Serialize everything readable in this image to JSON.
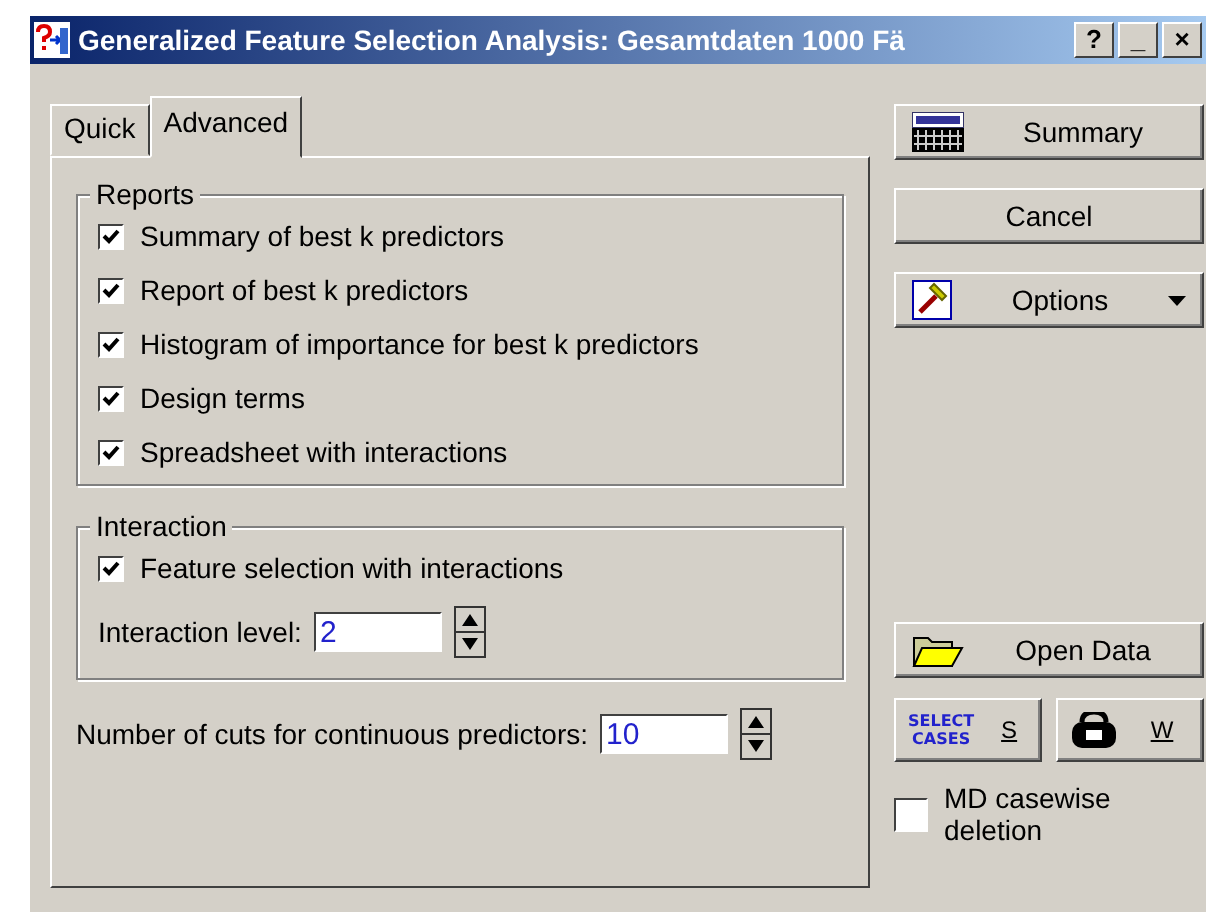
{
  "window": {
    "title": "Generalized Feature Selection Analysis: Gesamtdaten 1000 Fä",
    "controls": [
      "?",
      "_",
      "×"
    ]
  },
  "tabs": [
    {
      "label": "Quick",
      "selected": false
    },
    {
      "label": "Advanced",
      "selected": true
    }
  ],
  "reports": {
    "title": "Reports",
    "items": [
      {
        "label": "Summary of best k predictors",
        "checked": true
      },
      {
        "label": "Report of best k predictors",
        "checked": true
      },
      {
        "label": "Histogram of importance for best k predictors",
        "checked": true
      },
      {
        "label": "Design terms",
        "checked": true
      },
      {
        "label": "Spreadsheet with interactions",
        "checked": true
      }
    ]
  },
  "interaction": {
    "title": "Interaction",
    "option": {
      "label": "Feature selection with interactions",
      "checked": true
    },
    "level_label": "Interaction level:",
    "level_value": "2"
  },
  "cuts": {
    "label": "Number of cuts for continuous predictors:",
    "value": "10"
  },
  "buttons": {
    "summary": "Summary",
    "cancel": "Cancel",
    "options": "Options",
    "open_data": "Open Data",
    "select_cases_icon": [
      "SELECT",
      "CASES"
    ],
    "select_cases": "S",
    "weight": "W"
  },
  "md_casewise": {
    "label": "MD casewise deletion",
    "checked": false
  }
}
